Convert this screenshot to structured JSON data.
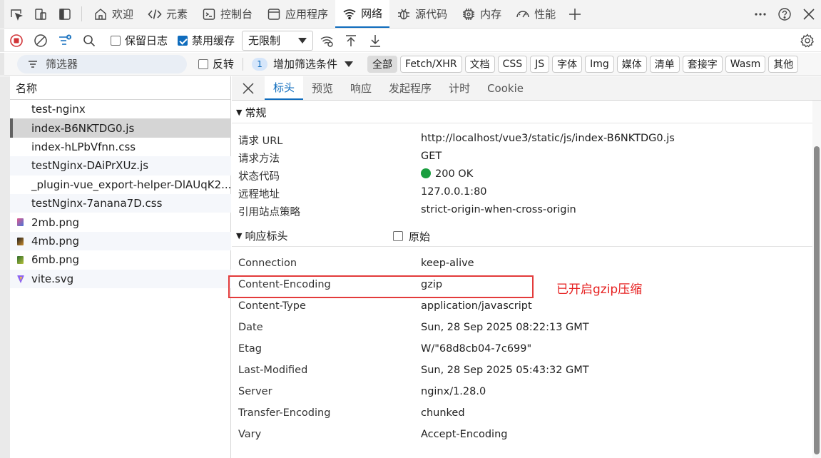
{
  "topbar": {
    "tabs": [
      {
        "label": "欢迎",
        "icon": "home-icon"
      },
      {
        "label": "元素",
        "icon": "code-icon"
      },
      {
        "label": "控制台",
        "icon": "console-icon"
      },
      {
        "label": "应用程序",
        "icon": "application-icon"
      },
      {
        "label": "网络",
        "icon": "wifi-icon",
        "active": true
      },
      {
        "label": "源代码",
        "icon": "bug-icon"
      },
      {
        "label": "内存",
        "icon": "memory-chip-icon"
      },
      {
        "label": "性能",
        "icon": "performance-gauge-icon"
      }
    ]
  },
  "toolbar": {
    "preserve_log": "保留日志",
    "disable_cache": "禁用缓存",
    "throttle": "无限制"
  },
  "filterbar": {
    "placeholder": "筛选器",
    "invert": "反转",
    "more_filters_count": "1",
    "more_filters": "增加筛选条件",
    "types": [
      "全部",
      "Fetch/XHR",
      "文档",
      "CSS",
      "JS",
      "字体",
      "Img",
      "媒体",
      "清单",
      "套接字",
      "Wasm",
      "其他"
    ]
  },
  "list": {
    "header": "名称",
    "rows": [
      {
        "name": "test-nginx"
      },
      {
        "name": "index-B6NKTDG0.js",
        "selected": true
      },
      {
        "name": "index-hLPbVfnn.css"
      },
      {
        "name": "testNginx-DAiPrXUz.js"
      },
      {
        "name": "_plugin-vue_export-helper-DlAUqK2..."
      },
      {
        "name": "testNginx-7anana7D.css"
      },
      {
        "name": "2mb.png",
        "icon": "image-file-icon"
      },
      {
        "name": "4mb.png",
        "icon": "image-file-icon"
      },
      {
        "name": "6mb.png",
        "icon": "image-file-icon"
      },
      {
        "name": "vite.svg",
        "icon": "svg-file-icon"
      }
    ]
  },
  "details": {
    "tabs": [
      "标头",
      "预览",
      "响应",
      "发起程序",
      "计时",
      "Cookie"
    ],
    "general": {
      "title": "常规",
      "rows": [
        {
          "key": "请求 URL",
          "value": "http://localhost/vue3/static/js/index-B6NKTDG0.js"
        },
        {
          "key": "请求方法",
          "value": "GET"
        },
        {
          "key": "状态代码",
          "value": "200 OK"
        },
        {
          "key": "远程地址",
          "value": "127.0.0.1:80"
        },
        {
          "key": "引用站点策略",
          "value": "strict-origin-when-cross-origin"
        }
      ]
    },
    "response_headers": {
      "title": "响应标头",
      "raw": "原始",
      "rows": [
        {
          "key": "Connection",
          "value": "keep-alive"
        },
        {
          "key": "Content-Encoding",
          "value": "gzip"
        },
        {
          "key": "Content-Type",
          "value": "application/javascript"
        },
        {
          "key": "Date",
          "value": "Sun, 28 Sep 2025 08:22:13 GMT"
        },
        {
          "key": "Etag",
          "value": "W/\"68d8cb04-7c699\""
        },
        {
          "key": "Last-Modified",
          "value": "Sun, 28 Sep 2025 05:43:32 GMT"
        },
        {
          "key": "Server",
          "value": "nginx/1.28.0"
        },
        {
          "key": "Transfer-Encoding",
          "value": "chunked"
        },
        {
          "key": "Vary",
          "value": "Accept-Encoding"
        }
      ]
    },
    "annotation": "已开启gzip压缩"
  },
  "colors": {
    "accent": "#0f6cbd",
    "annotation": "#e62020",
    "status_ok": "#1a9e3f"
  }
}
